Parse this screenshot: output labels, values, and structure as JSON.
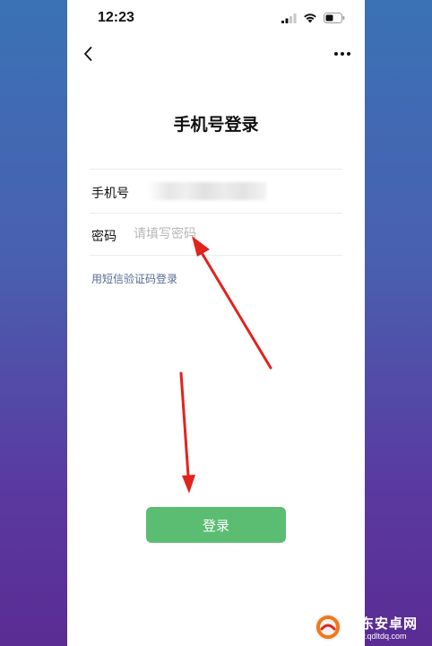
{
  "status_bar": {
    "time": "12:23",
    "icons": [
      "signal-icon",
      "wifi-icon",
      "battery-icon"
    ]
  },
  "nav": {
    "back_icon": "chevron-left-icon",
    "more_icon": "more-dots-icon"
  },
  "page": {
    "title": "手机号登录"
  },
  "form": {
    "phone_label": "手机号",
    "phone_value": "+",
    "password_label": "密码",
    "password_placeholder": "请填写密码",
    "sms_login_link": "用短信验证码登录"
  },
  "login_button": "登录",
  "annotations": {
    "arrow_color": "#e0241c"
  },
  "watermark": {
    "name": "启东安卓网",
    "url": "www.qdltdq.com"
  },
  "colors": {
    "accent_green": "#5bbd72",
    "link_blue": "#576b95"
  }
}
